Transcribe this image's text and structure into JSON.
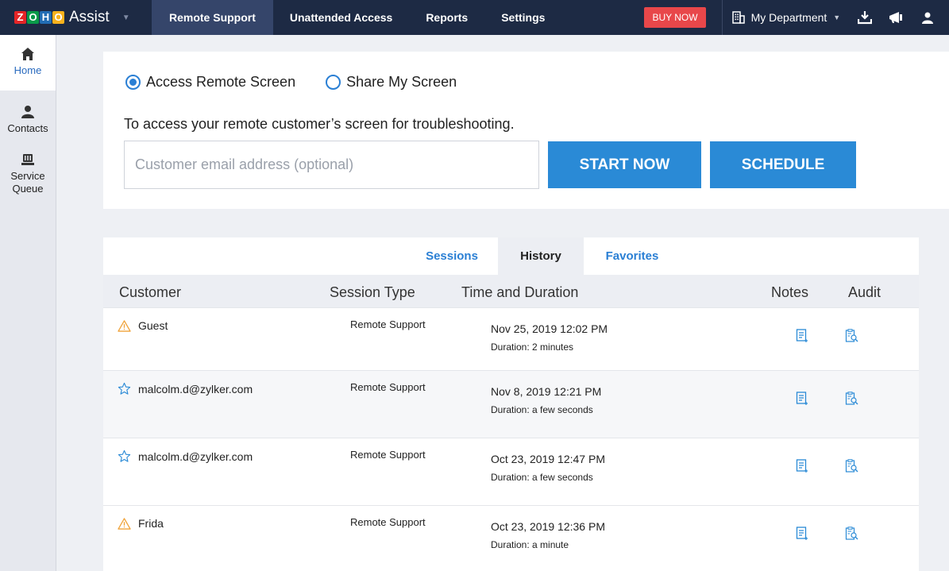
{
  "header": {
    "logo_letters": [
      "Z",
      "O",
      "H",
      "O"
    ],
    "logo_colors": [
      "#e42527",
      "#089949",
      "#226db4",
      "#f9b21d"
    ],
    "app_name": "Assist",
    "nav": [
      "Remote Support",
      "Unattended Access",
      "Reports",
      "Settings"
    ],
    "buy_now": "BUY NOW",
    "department": "My Department",
    "icons": [
      "download-icon",
      "announcement-icon",
      "user-icon"
    ]
  },
  "sidebar": {
    "items": [
      {
        "label": "Home",
        "icon": "home-icon"
      },
      {
        "label": "Contacts",
        "icon": "contacts-icon"
      },
      {
        "label": "Service Queue",
        "icon": "service-queue-icon"
      }
    ]
  },
  "connect": {
    "option_access": "Access Remote Screen",
    "option_share": "Share My Screen",
    "description": "To access your remote customer’s screen for troubleshooting.",
    "email_placeholder": "Customer email address (optional)",
    "start_now": "START NOW",
    "schedule": "SCHEDULE"
  },
  "tabs": {
    "sessions": "Sessions",
    "history": "History",
    "favorites": "Favorites"
  },
  "table": {
    "headers": {
      "customer": "Customer",
      "session_type": "Session Type",
      "time": "Time and Duration",
      "notes": "Notes",
      "audit": "Audit"
    },
    "rows": [
      {
        "customer": "Guest",
        "icon": "warning-icon",
        "type": "Remote Support",
        "time": "Nov 25, 2019 12:02 PM",
        "duration": "Duration: 2 minutes"
      },
      {
        "customer": "malcolm.d@zylker.com",
        "icon": "star-icon",
        "type": "Remote Support",
        "time": "Nov 8, 2019 12:21 PM",
        "duration": "Duration: a few seconds"
      },
      {
        "customer": "malcolm.d@zylker.com",
        "icon": "star-icon",
        "type": "Remote Support",
        "time": "Oct 23, 2019 12:47 PM",
        "duration": "Duration: a few seconds"
      },
      {
        "customer": "Frida",
        "icon": "warning-icon",
        "type": "Remote Support",
        "time": "Oct 23, 2019 12:36 PM",
        "duration": "Duration: a minute"
      }
    ]
  },
  "colors": {
    "topbar": "#1d2a44",
    "accent": "#2a8ad6",
    "buy_now": "#e8474a"
  }
}
